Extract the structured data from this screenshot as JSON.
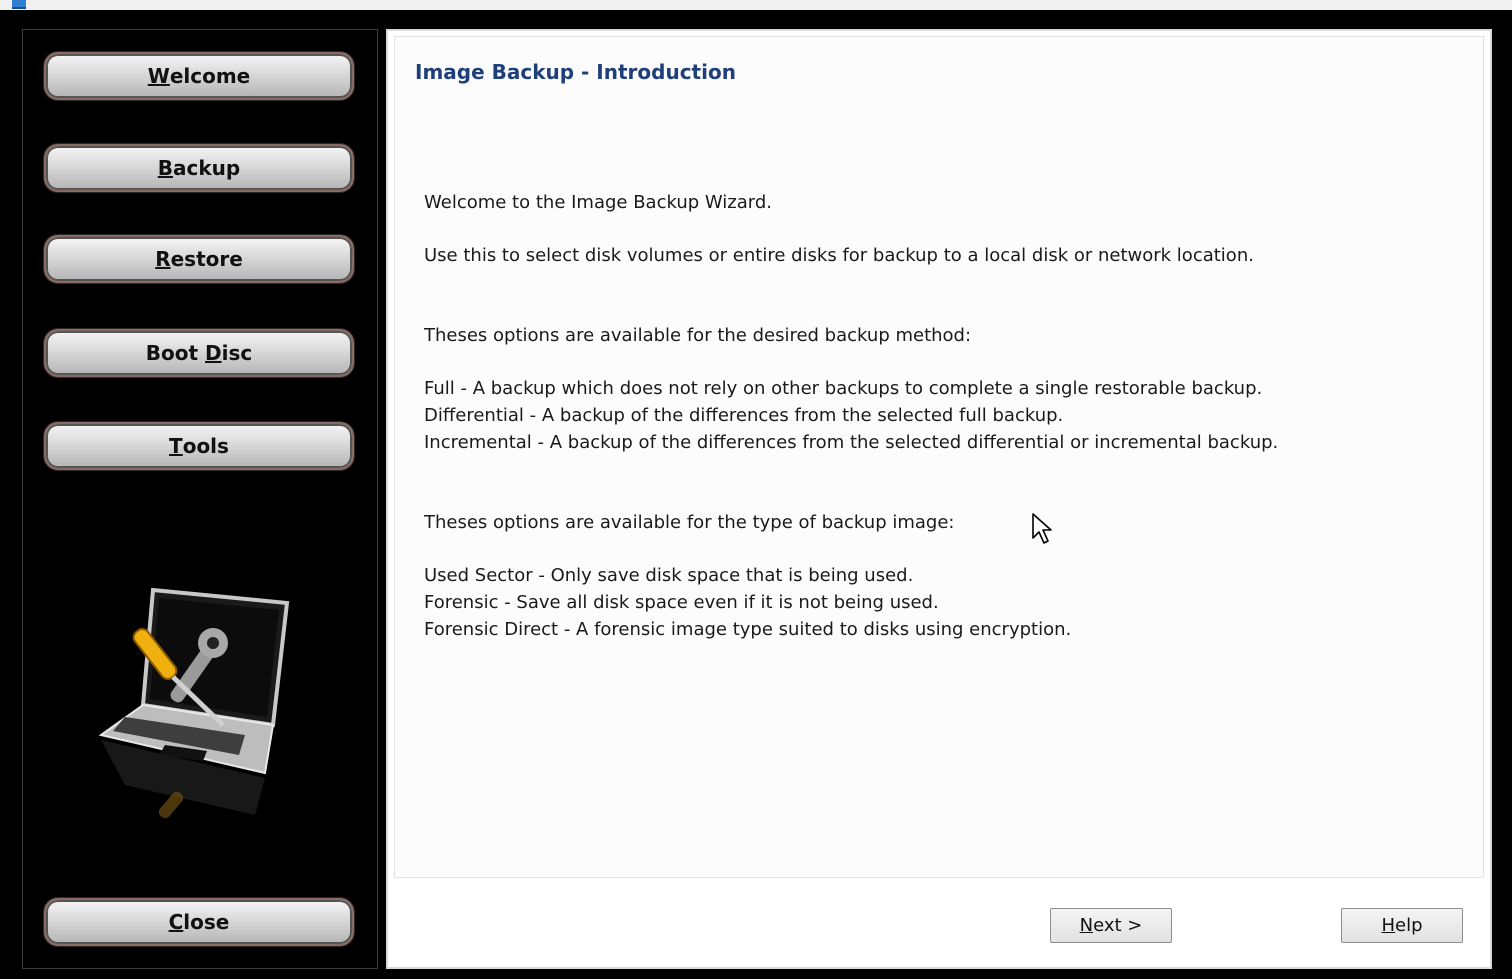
{
  "sidebar": {
    "buttons": [
      {
        "mnemonic": "W",
        "rest": "elcome"
      },
      {
        "mnemonic": "B",
        "rest": "ackup"
      },
      {
        "mnemonic": "R",
        "rest": "estore"
      },
      {
        "pre": "Boot ",
        "mnemonic": "D",
        "rest": "isc"
      },
      {
        "mnemonic": "T",
        "rest": "ools"
      }
    ],
    "close": {
      "mnemonic": "C",
      "rest": "lose"
    },
    "illustration": "laptop-with-tools-icon"
  },
  "main": {
    "title": "Image Backup - Introduction",
    "welcome": "Welcome to the Image Backup Wizard.",
    "use": "Use this to select disk volumes or entire disks for backup to a local disk or network location.",
    "method_heading": "Theses options are available for the desired backup method:",
    "methods": [
      "Full - A backup which does not rely on other backups to complete a single restorable backup.",
      "Differential - A backup of the differences from the selected full backup.",
      "Incremental - A backup of the differences from the selected differential or incremental backup."
    ],
    "type_heading": "Theses options are available for the type of backup image:",
    "types": [
      "Used Sector - Only save disk space that is being used.",
      "Forensic - Save all disk space even if it is not being used.",
      "Forensic Direct - A forensic image type suited to disks using encryption."
    ]
  },
  "footer": {
    "next": {
      "mnemonic": "N",
      "rest": "ext >"
    },
    "help": {
      "mnemonic": "H",
      "rest": "elp"
    }
  }
}
